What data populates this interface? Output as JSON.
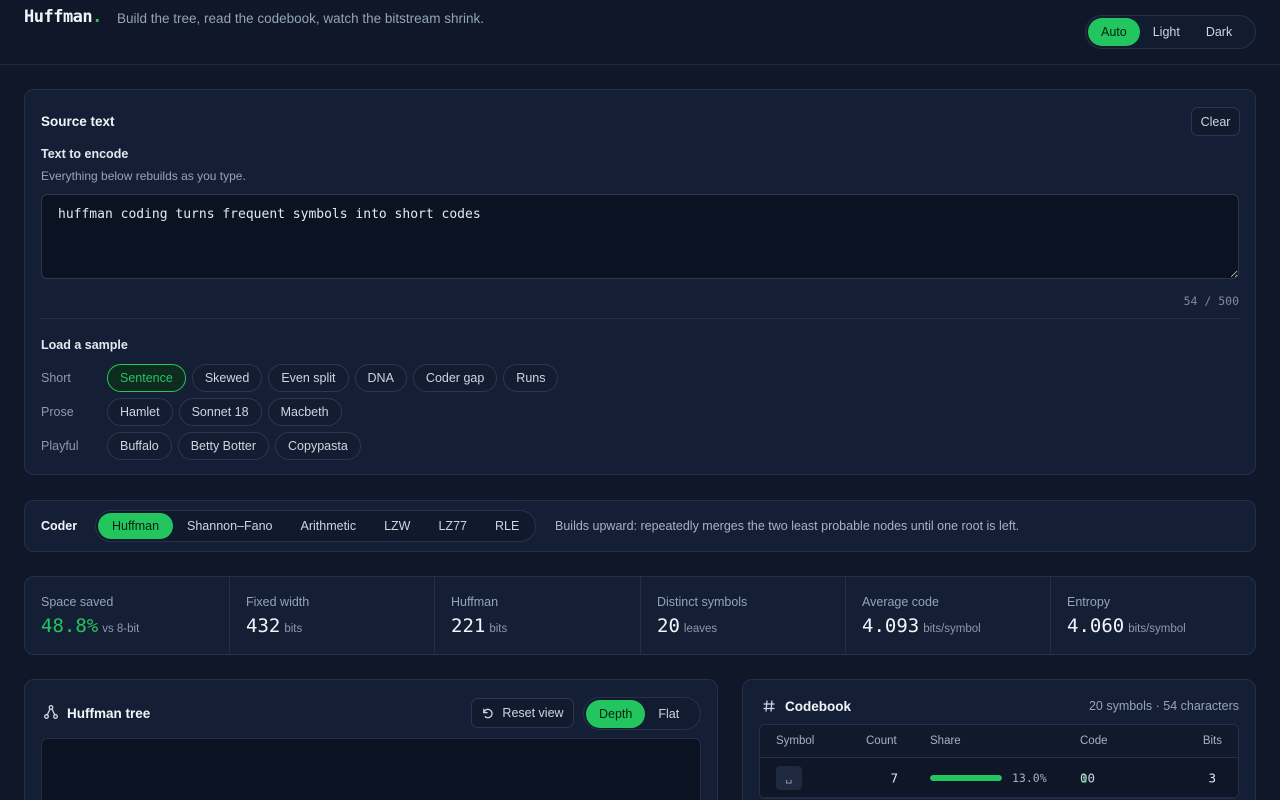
{
  "header": {
    "brand": "Huffman",
    "brand_dot": ".",
    "tagline": "Build the tree, read the codebook, watch the bitstream shrink.",
    "theme_options": [
      "Auto",
      "Light",
      "Dark"
    ],
    "theme_selected": "Auto"
  },
  "source": {
    "title": "Source text",
    "clear_label": "Clear",
    "field_label": "Text to encode",
    "field_hint": "Everything below rebuilds as you type.",
    "text": "huffman coding turns frequent symbols into short codes",
    "char_count": "54 / 500",
    "samples_title": "Load a sample",
    "sample_rows": [
      {
        "label": "Short",
        "items": [
          "Sentence",
          "Skewed",
          "Even split",
          "DNA",
          "Coder gap",
          "Runs"
        ]
      },
      {
        "label": "Prose",
        "items": [
          "Hamlet",
          "Sonnet 18",
          "Macbeth"
        ]
      },
      {
        "label": "Playful",
        "items": [
          "Buffalo",
          "Betty Botter",
          "Copypasta"
        ]
      }
    ],
    "sample_selected": "Sentence"
  },
  "coder": {
    "label": "Coder",
    "options": [
      "Huffman",
      "Shannon–Fano",
      "Arithmetic",
      "LZW",
      "LZ77",
      "RLE"
    ],
    "selected": "Huffman",
    "description": "Builds upward: repeatedly merges the two least probable nodes until one root is left."
  },
  "stats": [
    {
      "label": "Space saved",
      "value": "48.8%",
      "unit": "vs 8-bit",
      "accent": true
    },
    {
      "label": "Fixed width",
      "value": "432",
      "unit": "bits"
    },
    {
      "label": "Huffman",
      "value": "221",
      "unit": "bits"
    },
    {
      "label": "Distinct symbols",
      "value": "20",
      "unit": "leaves"
    },
    {
      "label": "Average code",
      "value": "4.093",
      "unit": "bits/symbol"
    },
    {
      "label": "Entropy",
      "value": "4.060",
      "unit": "bits/symbol"
    }
  ],
  "tree": {
    "title": "Huffman tree",
    "reset_label": "Reset view",
    "view_options": [
      "Depth",
      "Flat"
    ],
    "view_selected": "Depth"
  },
  "codebook": {
    "title": "Codebook",
    "summary": "20 symbols · 54 characters",
    "columns": [
      "Symbol",
      "Count",
      "Share",
      "Code",
      "Bits"
    ],
    "rows": [
      {
        "symbol": "␣",
        "count": "7",
        "share": "13.0%",
        "share_fraction": 0.13,
        "code_first": "1",
        "code_rest": "00",
        "bits": "3"
      }
    ]
  },
  "colors": {
    "accent": "#22c55e",
    "background": "#0f1729",
    "card": "#141f35"
  }
}
